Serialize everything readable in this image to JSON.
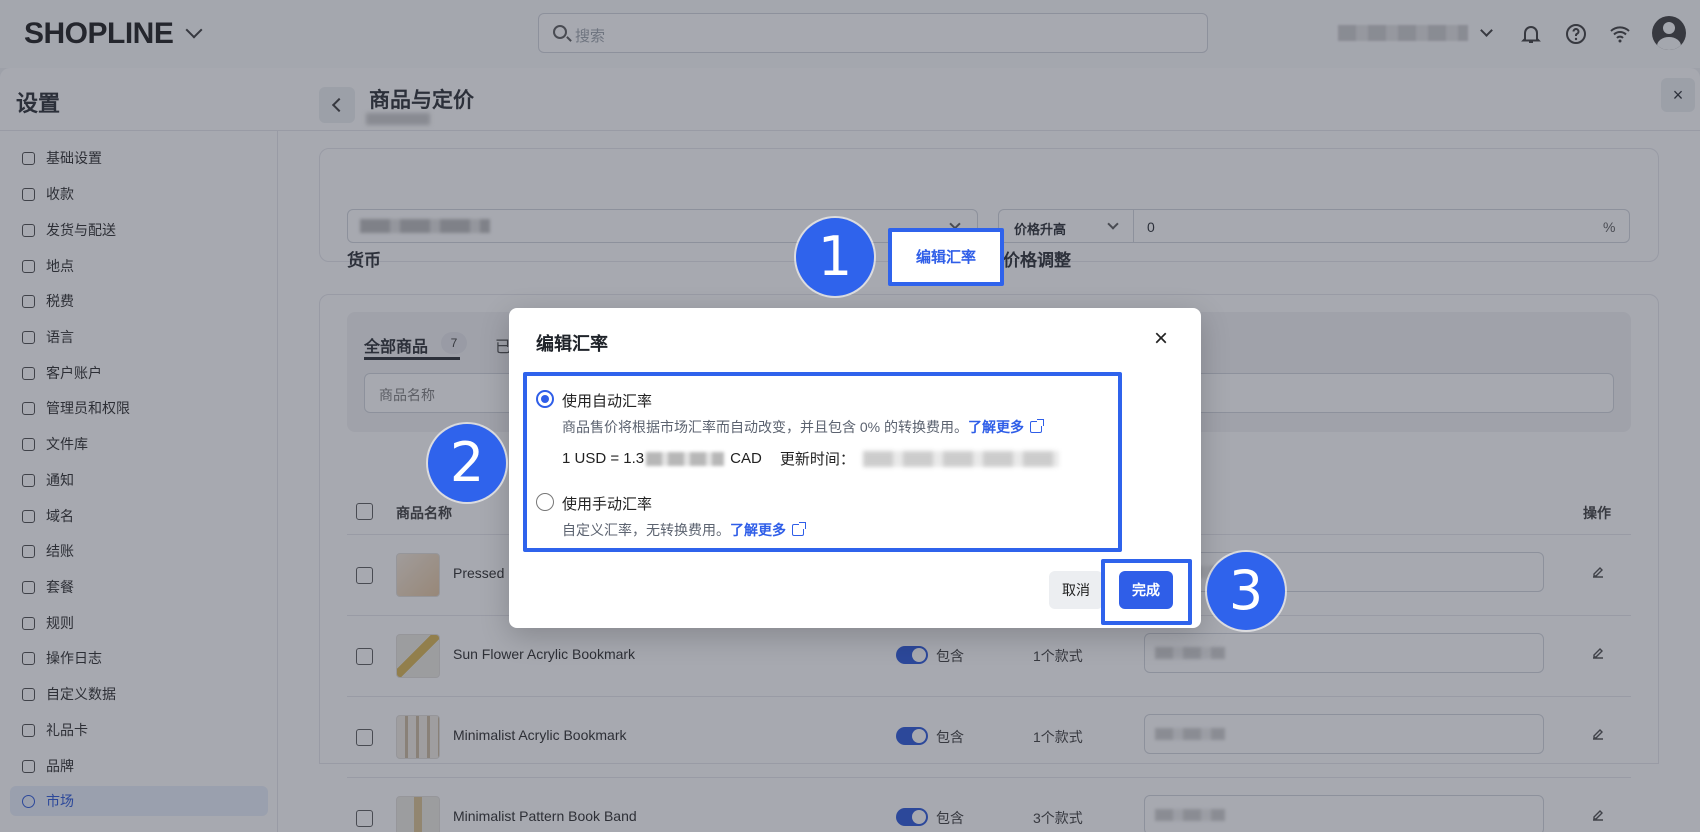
{
  "topbar": {
    "logo": "SHOPLINE",
    "search_placeholder": "搜索"
  },
  "settings": {
    "title": "设置",
    "close": "×"
  },
  "sidebar": {
    "items": [
      {
        "label": "基础设置"
      },
      {
        "label": "收款"
      },
      {
        "label": "发货与配送"
      },
      {
        "label": "地点"
      },
      {
        "label": "税费"
      },
      {
        "label": "语言"
      },
      {
        "label": "客户账户"
      },
      {
        "label": "管理员和权限"
      },
      {
        "label": "文件库"
      },
      {
        "label": "通知"
      },
      {
        "label": "域名"
      },
      {
        "label": "结账"
      },
      {
        "label": "套餐"
      },
      {
        "label": "规则"
      },
      {
        "label": "操作日志"
      },
      {
        "label": "自定义数据"
      },
      {
        "label": "礼品卡"
      },
      {
        "label": "品牌"
      },
      {
        "label": "市场",
        "active": true
      }
    ]
  },
  "main": {
    "title": "商品与定价",
    "currency_label": "货币",
    "edit_rate_link": "编辑汇率",
    "price_adjust_label": "价格调整",
    "price_adjust_mode": "价格升高",
    "price_adjust_value": "0",
    "price_adjust_unit": "%"
  },
  "products": {
    "tab_all": "全部商品",
    "tab_all_count": "7",
    "tab_other": "已",
    "search_placeholder": "商品名称",
    "col_name": "商品名称",
    "col_action": "操作",
    "rows": [
      {
        "name": "Pressed",
        "included": "",
        "variants": ""
      },
      {
        "name": "Sun Flower Acrylic Bookmark",
        "included": "包含",
        "variants": "1个款式"
      },
      {
        "name": "Minimalist Acrylic Bookmark",
        "included": "包含",
        "variants": "1个款式"
      },
      {
        "name": "Minimalist Pattern Book Band",
        "included": "包含",
        "variants": "3个款式"
      }
    ]
  },
  "modal": {
    "title": "编辑汇率",
    "auto_title": "使用自动汇率",
    "auto_desc": "商品售价将根据市场汇率而自动改变，并且包含 0% 的转换费用。",
    "learn_more": "了解更多",
    "rate_prefix": "1 USD = 1.3",
    "rate_suffix": "CAD",
    "update_time_label": "更新时间：",
    "manual_title": "使用手动汇率",
    "manual_desc": "自定义汇率，无转换费用。",
    "cancel": "取消",
    "done": "完成"
  },
  "annotations": [
    "1",
    "2",
    "3"
  ],
  "colors": {
    "accent": "#2f5ee8",
    "annotation": "#2f63ec"
  }
}
